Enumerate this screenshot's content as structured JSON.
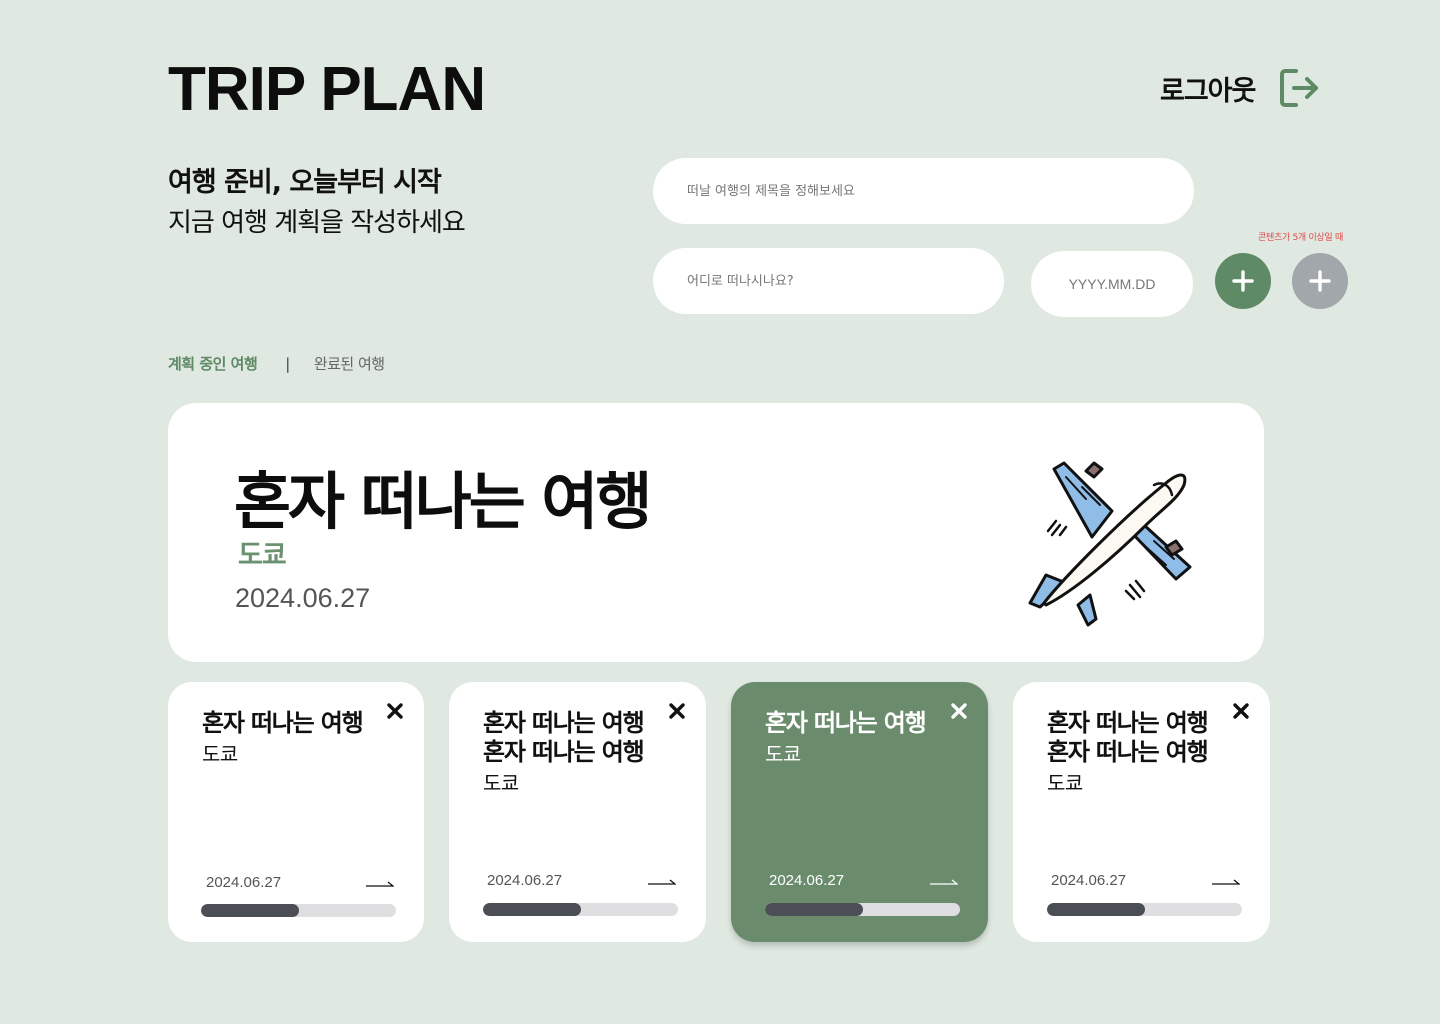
{
  "header": {
    "app_title": "TRIP PLAN",
    "logout_label": "로그아웃"
  },
  "intro": {
    "headline": "여행 준비, 오늘부터 시작",
    "subline": "지금 여행 계획을 작성하세요"
  },
  "form": {
    "title_placeholder": "떠날 여행의 제목을 정해보세요",
    "destination_placeholder": "어디로 떠나시나요?",
    "date_placeholder": "YYYY.MM.DD",
    "limit_note": "콘텐츠가 5개 이상일 때"
  },
  "tabs": {
    "active": "계획 중인 여행",
    "separator": "|",
    "inactive": "완료된 여행"
  },
  "featured": {
    "title": "혼자 떠나는 여행",
    "destination": "도쿄",
    "date": "2024.06.27"
  },
  "cards": [
    {
      "line1": "혼자 떠나는 여행",
      "line2": "",
      "destination": "도쿄",
      "date": "2024.06.27",
      "progress": 0.5
    },
    {
      "line1": "혼자 떠나는 여행",
      "line2": "혼자 떠나는 여행",
      "destination": "도쿄",
      "date": "2024.06.27",
      "progress": 0.5
    },
    {
      "line1": "혼자 떠나는 여행",
      "line2": "",
      "destination": "도쿄",
      "date": "2024.06.27",
      "progress": 0.5
    },
    {
      "line1": "혼자 떠나는 여행",
      "line2": "혼자 떠나는 여행",
      "destination": "도쿄",
      "date": "2024.06.27",
      "progress": 0.5
    }
  ],
  "icons": {
    "logout": "logout-icon",
    "add": "plus-icon",
    "close": "close-icon",
    "arrow": "arrow-right-icon",
    "illustration": "airplane-icon"
  },
  "colors": {
    "background": "#dfe8e1",
    "accent": "#5e8a65",
    "card_active": "#6a8c6d",
    "disabled": "#a2a7ab",
    "warning": "#e04a4a",
    "progress": "#4b4e55"
  }
}
